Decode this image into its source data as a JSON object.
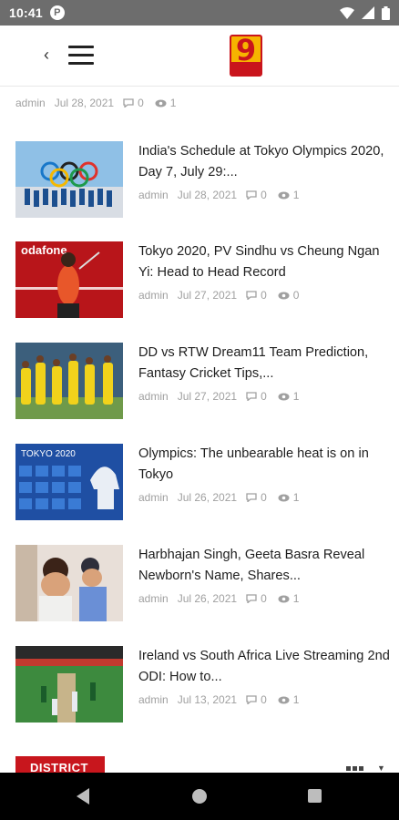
{
  "status_bar": {
    "time": "10:41",
    "badge": "P"
  },
  "header": {
    "back_glyph": "‹",
    "logo_text": "9"
  },
  "top_meta": {
    "author": "admin",
    "date": "Jul 28, 2021",
    "comments": "0",
    "views": "1"
  },
  "articles": [
    {
      "title": "India's Schedule at Tokyo Olympics 2020, Day 7, July 29:...",
      "author": "admin",
      "date": "Jul 28, 2021",
      "comments": "0",
      "views": "1"
    },
    {
      "title": "Tokyo 2020, PV Sindhu vs Cheung Ngan Yi: Head to Head Record",
      "author": "admin",
      "date": "Jul 27, 2021",
      "comments": "0",
      "views": "0"
    },
    {
      "title": "DD vs RTW Dream11 Team Prediction, Fantasy Cricket Tips,...",
      "author": "admin",
      "date": "Jul 27, 2021",
      "comments": "0",
      "views": "1"
    },
    {
      "title": "Olympics: The unbearable heat is on in Tokyo",
      "author": "admin",
      "date": "Jul 26, 2021",
      "comments": "0",
      "views": "1"
    },
    {
      "title": "Harbhajan Singh, Geeta Basra Reveal Newborn's Name, Shares...",
      "author": "admin",
      "date": "Jul 26, 2021",
      "comments": "0",
      "views": "1"
    },
    {
      "title": "Ireland vs South Africa Live Streaming 2nd ODI: How to...",
      "author": "admin",
      "date": "Jul 13, 2021",
      "comments": "0",
      "views": "1"
    }
  ],
  "section": {
    "label": "DISTRICT"
  },
  "thumb_text": {
    "tokyo": "TOKYO 2020",
    "sindhu_banner": "odafone"
  }
}
